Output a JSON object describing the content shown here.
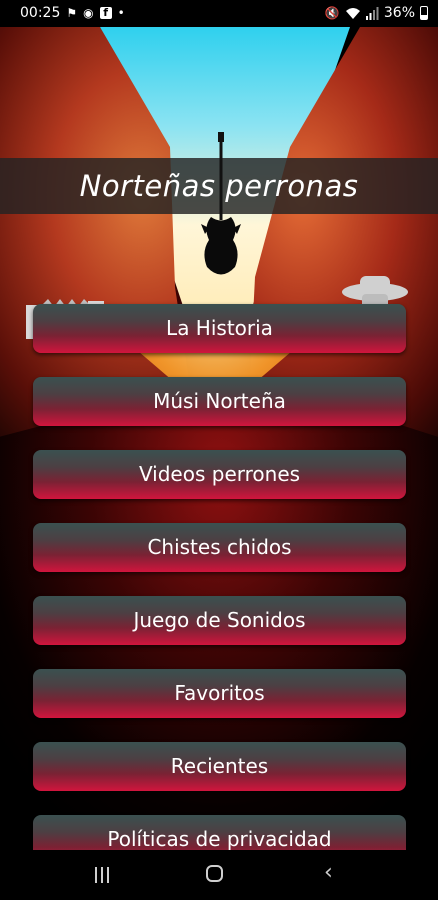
{
  "status_bar": {
    "time": "00:25",
    "battery": "36%",
    "icons": [
      "flag-icon",
      "messenger-icon",
      "facebook-icon",
      "dot-icon",
      "mute-icon",
      "wifi-icon",
      "signal-icon",
      "battery-icon"
    ]
  },
  "app": {
    "title": "Norteñas perronas"
  },
  "menu": {
    "items": [
      {
        "label": "La Historia"
      },
      {
        "label": "Músi Norteña"
      },
      {
        "label": "Videos perrones"
      },
      {
        "label": "Chistes chidos"
      },
      {
        "label": "Juego de Sonidos"
      },
      {
        "label": "Favoritos"
      },
      {
        "label": "Recientes"
      },
      {
        "label": "Políticas de privacidad"
      }
    ]
  },
  "nav_bar": {
    "icons": [
      "recents-icon",
      "home-icon",
      "back-icon"
    ]
  },
  "colors": {
    "button_top": "#3a5150",
    "button_bottom": "#d1153d",
    "title_band": "#232323",
    "background": "#000000"
  }
}
